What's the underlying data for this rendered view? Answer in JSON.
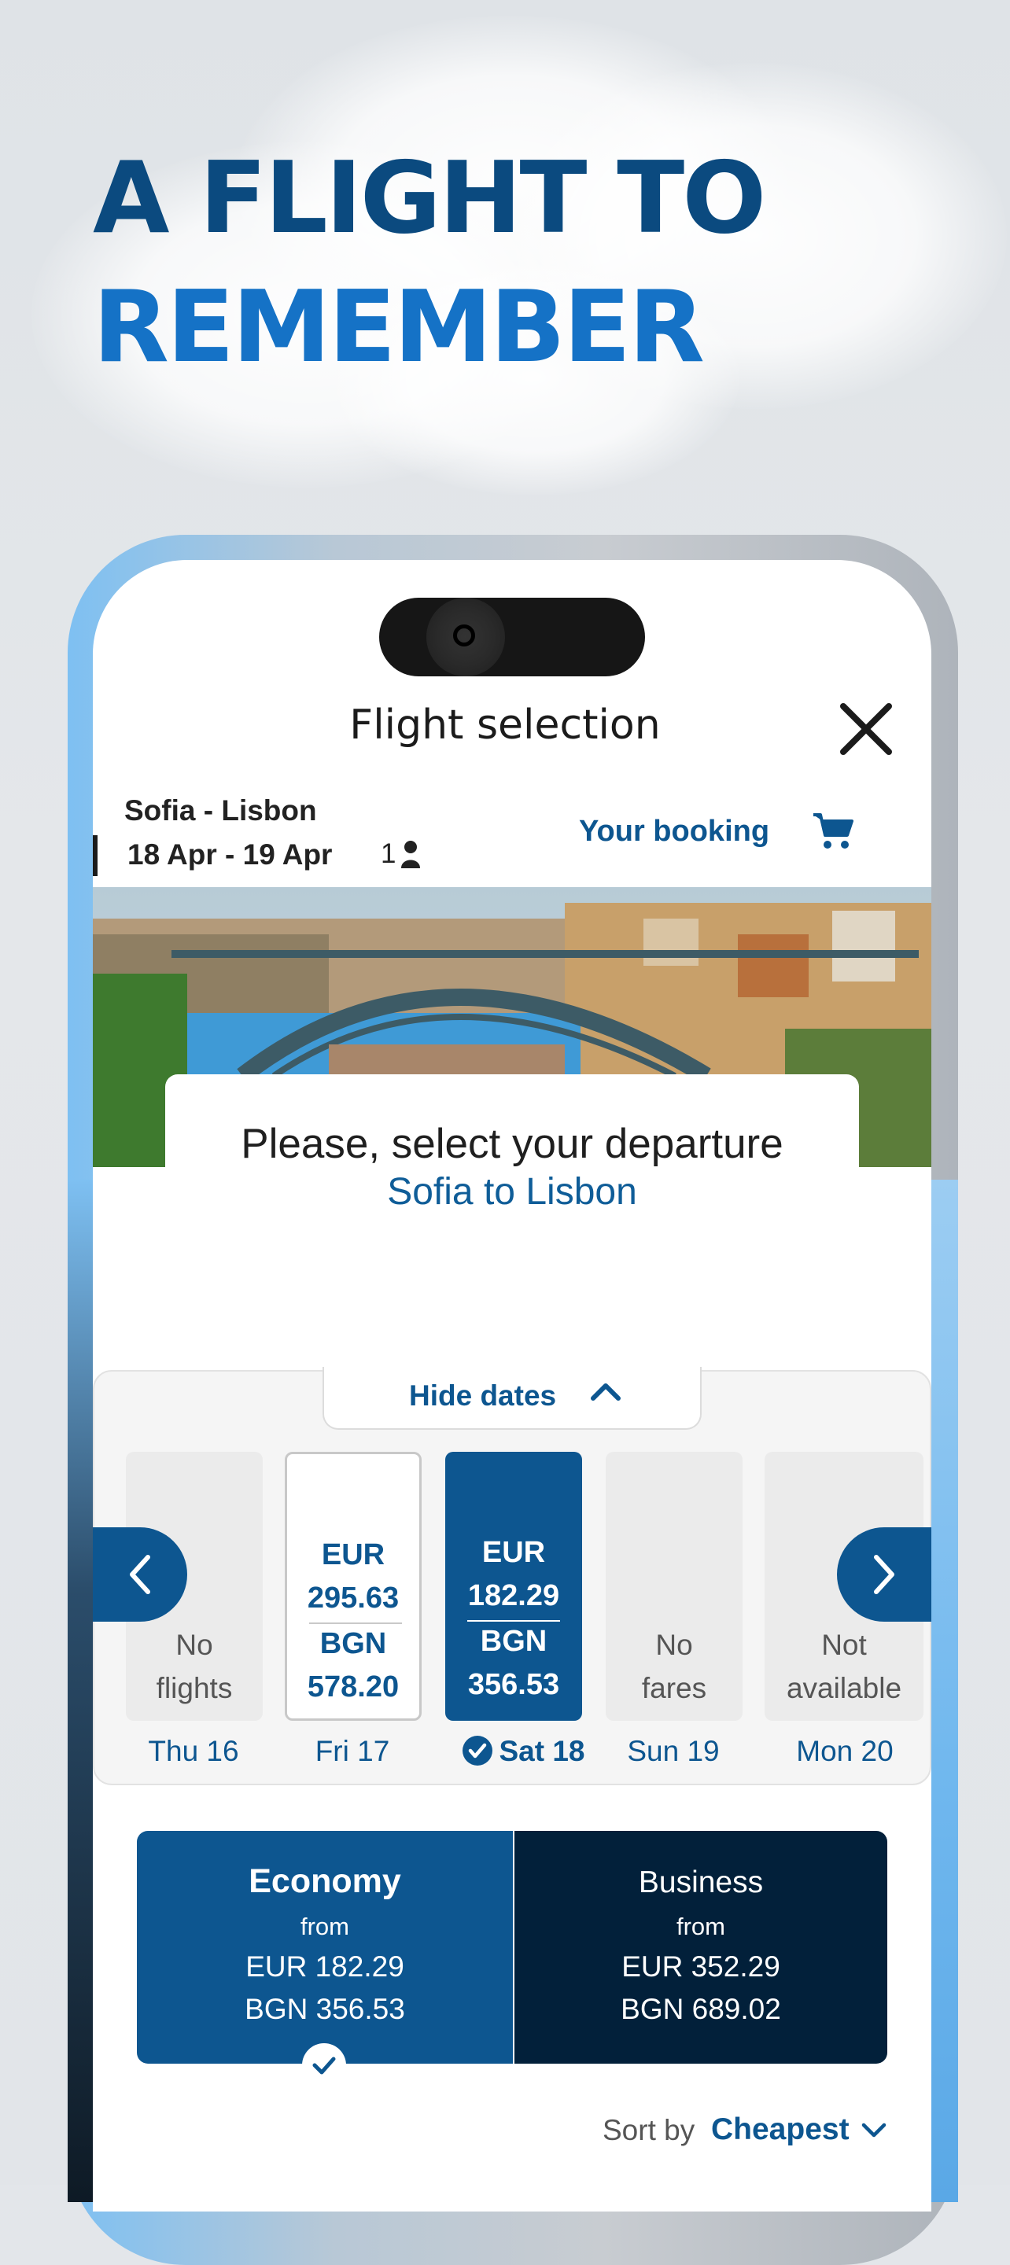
{
  "promo": {
    "line1": "A FLIGHT TO",
    "line2": "REMEMBER"
  },
  "header": {
    "title": "Flight selection",
    "close_icon": "close-icon"
  },
  "trip": {
    "route": "Sofia - Lisbon",
    "dates": "18 Apr - 19 Apr",
    "passengers": "1",
    "booking_label": "Your booking"
  },
  "selection": {
    "prompt": "Please, select your departure",
    "route": "Sofia to Lisbon"
  },
  "date_picker": {
    "hide_label": "Hide dates",
    "days": [
      {
        "label": "Thu 16",
        "message": [
          "No",
          "flights"
        ]
      },
      {
        "label": "Fri 17",
        "eur": "EUR",
        "eur_price": "295.63",
        "bgn": "BGN",
        "bgn_price": "578.20"
      },
      {
        "label": "Sat 18",
        "eur": "EUR",
        "eur_price": "182.29",
        "bgn": "BGN",
        "bgn_price": "356.53",
        "selected": true
      },
      {
        "label": "Sun 19",
        "message": [
          "No",
          "fares"
        ]
      },
      {
        "label": "Mon 20",
        "message": [
          "Not",
          "available"
        ]
      }
    ]
  },
  "fares": [
    {
      "name": "Economy",
      "from": "from",
      "eur": "EUR 182.29",
      "bgn": "BGN 356.53",
      "selected": true
    },
    {
      "name": "Business",
      "from": "from",
      "eur": "EUR 352.29",
      "bgn": "BGN 689.02"
    }
  ],
  "sort": {
    "label": "Sort by",
    "value": "Cheapest"
  },
  "colors": {
    "primary": "#0d5690",
    "accent": "#1572c6",
    "dark": "#02203a"
  }
}
